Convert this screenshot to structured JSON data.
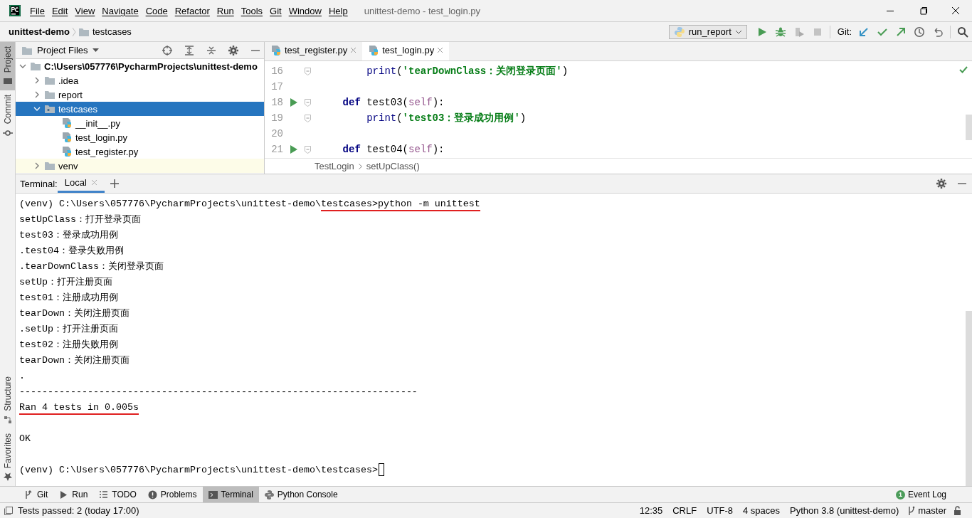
{
  "window": {
    "title": "unittest-demo - test_login.py"
  },
  "menu": [
    "File",
    "Edit",
    "View",
    "Navigate",
    "Code",
    "Refactor",
    "Run",
    "Tools",
    "Git",
    "Window",
    "Help"
  ],
  "breadcrumb": [
    "unittest-demo",
    "testcases"
  ],
  "toolbar": {
    "run_config": "run_report",
    "git_label": "Git:"
  },
  "left_strip_top": [
    {
      "label": "Project",
      "selected": true
    },
    {
      "label": "Commit",
      "selected": false
    }
  ],
  "left_strip_bottom": [
    {
      "label": "Structure",
      "selected": false
    },
    {
      "label": "Favorites",
      "selected": false
    }
  ],
  "project_panel": {
    "title": "Project Files",
    "tree": [
      {
        "label": "C:\\Users\\057776\\PycharmProjects\\unittest-demo",
        "kind": "root",
        "expanded": true,
        "selected": false,
        "ignored": false,
        "children": [
          {
            "label": ".idea",
            "kind": "folder",
            "expanded": false,
            "selected": false,
            "ignored": false
          },
          {
            "label": "report",
            "kind": "folder",
            "expanded": false,
            "selected": false,
            "ignored": false
          },
          {
            "label": "testcases",
            "kind": "package",
            "expanded": true,
            "selected": true,
            "ignored": false,
            "children": [
              {
                "label": "__init__.py",
                "kind": "python",
                "selected": false,
                "ignored": false
              },
              {
                "label": "test_login.py",
                "kind": "python",
                "selected": false,
                "ignored": false
              },
              {
                "label": "test_register.py",
                "kind": "python",
                "selected": false,
                "ignored": false
              }
            ]
          },
          {
            "label": "venv",
            "kind": "folder",
            "expanded": false,
            "selected": false,
            "ignored": true
          }
        ]
      }
    ]
  },
  "editor": {
    "tabs": [
      {
        "label": "test_register.py",
        "selected": false
      },
      {
        "label": "test_login.py",
        "selected": true
      }
    ],
    "lines": [
      {
        "number": "16",
        "kind": "body",
        "runnable": false,
        "tokens": [
          {
            "kind": "builtin",
            "text": "print"
          },
          {
            "kind": "plain",
            "text": "("
          },
          {
            "kind": "string",
            "text": "'tearDownClass：关闭登录页面'"
          },
          {
            "kind": "plain",
            "text": ")"
          }
        ]
      },
      {
        "number": "17",
        "kind": "blank",
        "runnable": false
      },
      {
        "number": "18",
        "kind": "def",
        "runnable": true,
        "tokens": [
          {
            "kind": "keyword",
            "text": "def "
          },
          {
            "kind": "plain",
            "text": "test03("
          },
          {
            "kind": "self",
            "text": "self"
          },
          {
            "kind": "plain",
            "text": "):"
          }
        ]
      },
      {
        "number": "19",
        "kind": "body",
        "runnable": false,
        "tokens": [
          {
            "kind": "builtin",
            "text": "print"
          },
          {
            "kind": "plain",
            "text": "("
          },
          {
            "kind": "string",
            "text": "'test03：登录成功用例'"
          },
          {
            "kind": "plain",
            "text": ")"
          }
        ]
      },
      {
        "number": "20",
        "kind": "blank",
        "runnable": false
      },
      {
        "number": "21",
        "kind": "def",
        "runnable": true,
        "tokens": [
          {
            "kind": "keyword",
            "text": "def "
          },
          {
            "kind": "plain",
            "text": "test04("
          },
          {
            "kind": "self",
            "text": "self"
          },
          {
            "kind": "plain",
            "text": "):"
          }
        ]
      }
    ],
    "breadcrumb": [
      "TestLogin",
      "setUpClass()"
    ]
  },
  "terminal": {
    "label": "Terminal:",
    "tabs": [
      {
        "label": "Local",
        "selected": true
      }
    ],
    "lines": [
      {
        "kind": "text",
        "parts": [
          {
            "text": "(venv) C:\\Users\\057776\\PycharmProjects\\unittest-demo\\",
            "marked": false
          },
          {
            "text": "testcases>python -m unittest",
            "marked": true
          }
        ]
      },
      {
        "kind": "text",
        "parts": [
          {
            "text": "setUpClass：打开登录页面",
            "marked": false
          }
        ]
      },
      {
        "kind": "text",
        "parts": [
          {
            "text": "test03：登录成功用例",
            "marked": false
          }
        ]
      },
      {
        "kind": "text",
        "parts": [
          {
            "text": ".test04：登录失败用例",
            "marked": false
          }
        ]
      },
      {
        "kind": "text",
        "parts": [
          {
            "text": ".tearDownClass：关闭登录页面",
            "marked": false
          }
        ]
      },
      {
        "kind": "text",
        "parts": [
          {
            "text": "setUp：打开注册页面",
            "marked": false
          }
        ]
      },
      {
        "kind": "text",
        "parts": [
          {
            "text": "test01：注册成功用例",
            "marked": false
          }
        ]
      },
      {
        "kind": "text",
        "parts": [
          {
            "text": "tearDown：关闭注册页面",
            "marked": false
          }
        ]
      },
      {
        "kind": "text",
        "parts": [
          {
            "text": ".setUp：打开注册页面",
            "marked": false
          }
        ]
      },
      {
        "kind": "text",
        "parts": [
          {
            "text": "test02：注册失败用例",
            "marked": false
          }
        ]
      },
      {
        "kind": "text",
        "parts": [
          {
            "text": "tearDown：关闭注册页面",
            "marked": false
          }
        ]
      },
      {
        "kind": "text",
        "parts": [
          {
            "text": ".",
            "marked": false
          }
        ]
      },
      {
        "kind": "text",
        "parts": [
          {
            "text": "----------------------------------------------------------------------",
            "marked": false
          }
        ]
      },
      {
        "kind": "text",
        "parts": [
          {
            "text": "Ran 4 tests in 0.005s",
            "marked": true
          }
        ]
      },
      {
        "kind": "blank"
      },
      {
        "kind": "text",
        "parts": [
          {
            "text": "OK",
            "marked": false
          }
        ]
      },
      {
        "kind": "blank"
      },
      {
        "kind": "prompt",
        "parts": [
          {
            "text": "(venv) C:\\Users\\057776\\PycharmProjects\\unittest-demo\\testcases>",
            "marked": false
          }
        ]
      }
    ]
  },
  "tool_windows": [
    {
      "label": "Git",
      "kind": "git",
      "selected": false
    },
    {
      "label": "Run",
      "kind": "run",
      "selected": false
    },
    {
      "label": "TODO",
      "kind": "todo",
      "selected": false
    },
    {
      "label": "Problems",
      "kind": "problems",
      "selected": false
    },
    {
      "label": "Terminal",
      "kind": "terminal",
      "selected": true
    },
    {
      "label": "Python Console",
      "kind": "console",
      "selected": false
    }
  ],
  "event_log": {
    "count": "1",
    "label": "Event Log"
  },
  "status_bar": {
    "message": "Tests passed: 2 (today 17:00)",
    "items": [
      "12:35",
      "CRLF",
      "UTF-8",
      "4 spaces",
      "Python 3.8 (unittest-demo)"
    ],
    "branch": "master"
  }
}
